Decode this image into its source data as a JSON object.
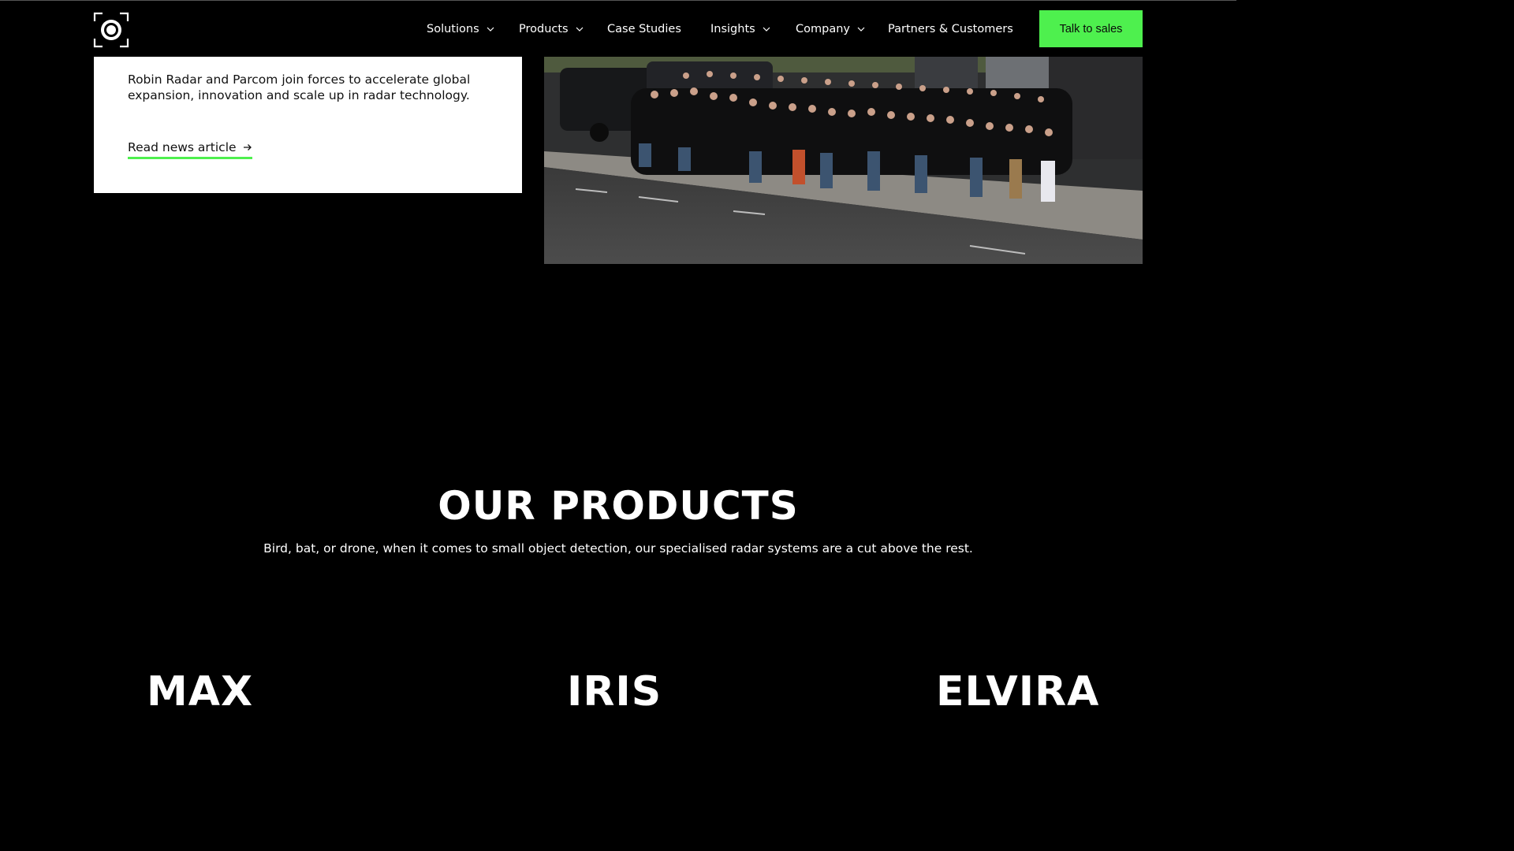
{
  "colors": {
    "accent": "#4ef04e",
    "background": "#000000",
    "card": "#ffffff"
  },
  "header": {
    "logo": "robin-radar-logo",
    "nav": [
      {
        "label": "Solutions",
        "has_dropdown": true
      },
      {
        "label": "Products",
        "has_dropdown": true
      },
      {
        "label": "Case Studies",
        "has_dropdown": false
      },
      {
        "label": "Insights",
        "has_dropdown": true
      },
      {
        "label": "Company",
        "has_dropdown": true
      },
      {
        "label": "Partners & Customers",
        "has_dropdown": false
      }
    ],
    "cta_label": "Talk to sales"
  },
  "news": {
    "text": "Robin Radar and Parcom join forces to accelerate global expansion, innovation and scale up in radar technology.",
    "link_label": "Read news article",
    "link_icon": "arrow-right-icon"
  },
  "photo": {
    "subject": "team group photo"
  },
  "products": {
    "title": "OUR PRODUCTS",
    "subtitle": "Bird, bat, or drone, when it comes to small object detection, our specialised radar systems are a cut above the rest.",
    "items": [
      "MAX",
      "IRIS",
      "ELVIRA"
    ]
  }
}
